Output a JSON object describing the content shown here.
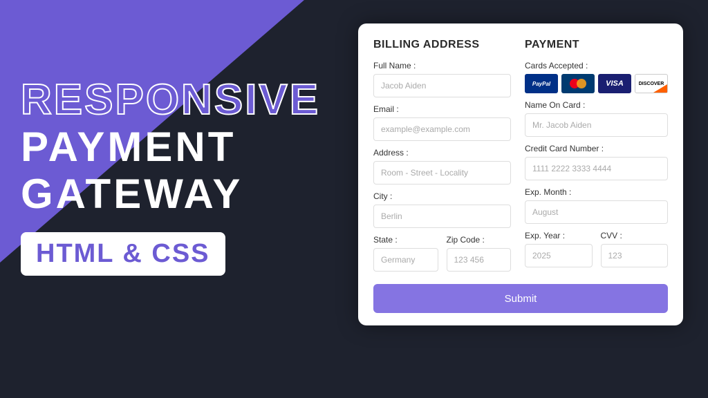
{
  "hero": {
    "line1": "RESPONSIVE",
    "line2": "PAYMENT",
    "line3": "GATEWAY",
    "tag": "HTML & CSS"
  },
  "billing": {
    "title": "BILLING ADDRESS",
    "fullName": {
      "label": "Full Name :",
      "placeholder": "Jacob Aiden"
    },
    "email": {
      "label": "Email :",
      "placeholder": "example@example.com"
    },
    "address": {
      "label": "Address :",
      "placeholder": "Room - Street - Locality"
    },
    "city": {
      "label": "City :",
      "placeholder": "Berlin"
    },
    "state": {
      "label": "State :",
      "placeholder": "Germany"
    },
    "zip": {
      "label": "Zip Code :",
      "placeholder": "123 456"
    }
  },
  "payment": {
    "title": "PAYMENT",
    "cardsAccepted": "Cards Accepted :",
    "nameOnCard": {
      "label": "Name On Card :",
      "placeholder": "Mr. Jacob Aiden"
    },
    "cardNumber": {
      "label": "Credit Card Number :",
      "placeholder": "1111 2222 3333 4444"
    },
    "expMonth": {
      "label": "Exp. Month :",
      "placeholder": "August"
    },
    "expYear": {
      "label": "Exp. Year :",
      "placeholder": "2025"
    },
    "cvv": {
      "label": "CVV :",
      "placeholder": "123"
    }
  },
  "cards": {
    "paypal": "PayPal",
    "visa": "VISA",
    "discover": "DISCOVER"
  },
  "submit": "Submit"
}
